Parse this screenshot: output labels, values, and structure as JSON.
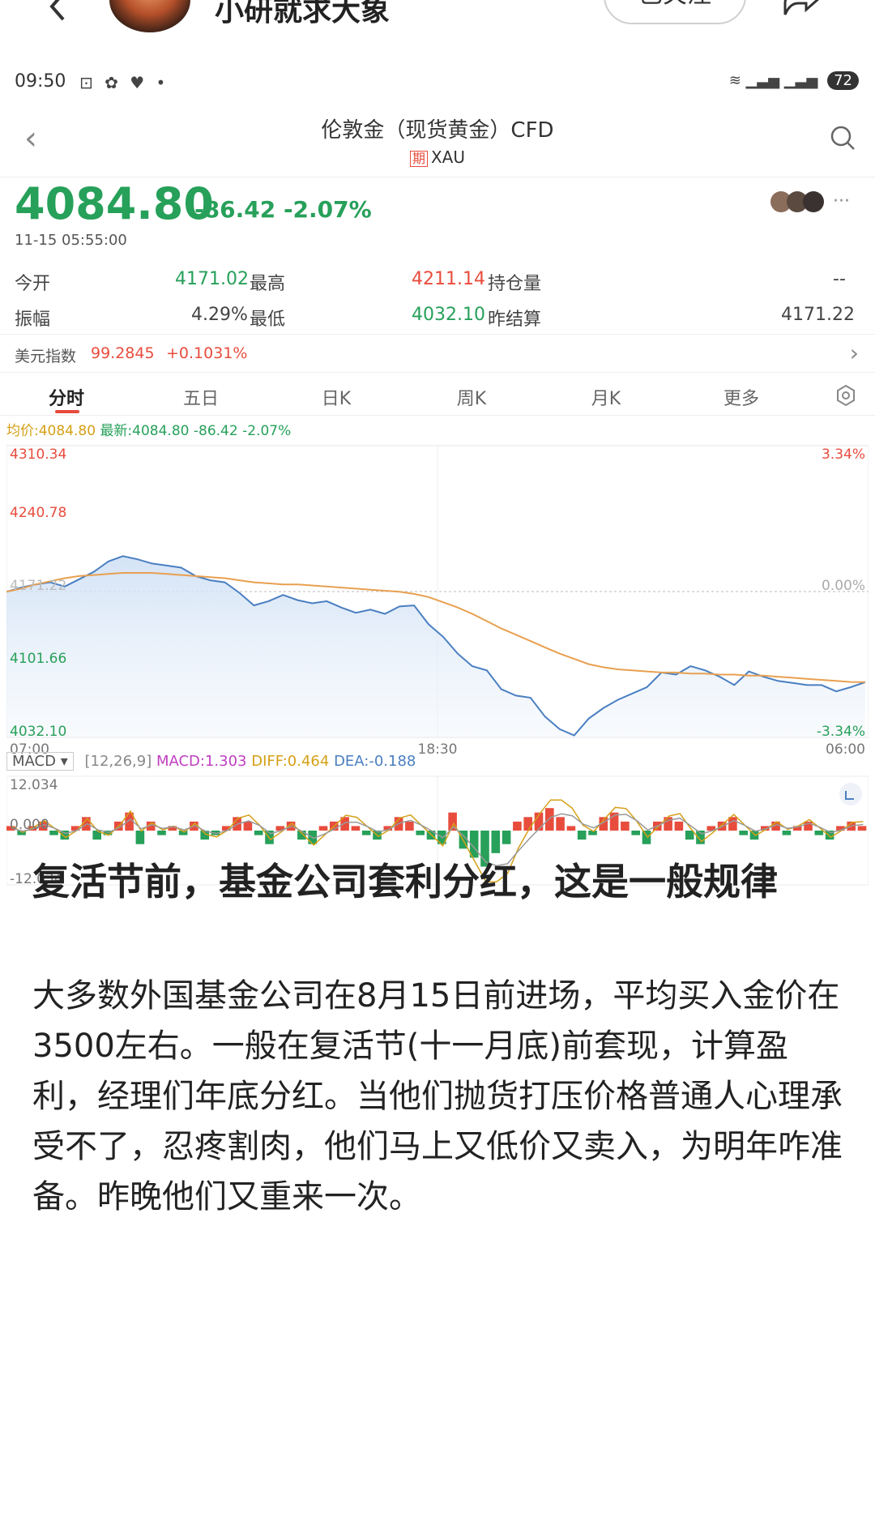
{
  "outer": {
    "author_name": "小研就求大象",
    "follow_label": "已关注"
  },
  "status_bar": {
    "time": "09:50",
    "battery": "72"
  },
  "header": {
    "title": "伦敦金（现货黄金）CFD",
    "badge": "期",
    "symbol": "XAU"
  },
  "quote": {
    "price": "4084.80",
    "change": "-86.42",
    "change_pct": "-2.07%",
    "timestamp": "11-15 05:55:00"
  },
  "stats": {
    "open_label": "今开",
    "open": "4171.02",
    "high_label": "最高",
    "high": "4211.14",
    "oi_label": "持仓量",
    "oi": "--",
    "amp_label": "振幅",
    "amp": "4.29%",
    "low_label": "最低",
    "low": "4032.10",
    "prev_label": "昨结算",
    "prev": "4171.22"
  },
  "dxy": {
    "label": "美元指数",
    "value": "99.2845",
    "change": "+0.1031%"
  },
  "tabs": [
    "分时",
    "五日",
    "日K",
    "周K",
    "月K",
    "更多"
  ],
  "legend": {
    "avg": "均价:4084.80",
    "latest": "最新:4084.80",
    "change": "-86.42",
    "pct": "-2.07%"
  },
  "chart_data": [
    {
      "type": "line",
      "y_ticks_left": [
        "4310.34",
        "4240.78",
        "4171.22",
        "4101.66",
        "4032.10"
      ],
      "y_ticks_right": [
        "3.34%",
        "0.00%",
        "-3.34%"
      ],
      "x_ticks": [
        "07:00",
        "18:30",
        "06:00"
      ],
      "ylim": [
        4032.1,
        4310.34
      ],
      "series": [
        {
          "values": [
            4171,
            4175,
            4178,
            4180,
            4176,
            4183,
            4190,
            4200,
            4205,
            4202,
            4198,
            4196,
            4194,
            4186,
            4182,
            4180,
            4170,
            4158,
            4162,
            4168,
            4163,
            4160,
            4162,
            4156,
            4151,
            4154,
            4150,
            4157,
            4158,
            4140,
            4128,
            4112,
            4100,
            4096,
            4078,
            4072,
            4070,
            4052,
            4040,
            4034,
            4050,
            4060,
            4068,
            4074,
            4080,
            4094,
            4092,
            4100,
            4096,
            4090,
            4082,
            4095,
            4090,
            4086,
            4084,
            4082,
            4082,
            4076,
            4080,
            4084.8
          ],
          "color": "#4a7fc1"
        },
        {
          "values": [
            4171,
            4174,
            4178,
            4181,
            4184,
            4186,
            4187,
            4188,
            4189,
            4189,
            4189,
            4188,
            4187,
            4186,
            4185,
            4184,
            4182,
            4180,
            4179,
            4178,
            4178,
            4177,
            4176,
            4175,
            4174,
            4173,
            4172,
            4171,
            4169,
            4166,
            4161,
            4156,
            4150,
            4143,
            4136,
            4130,
            4124,
            4118,
            4112,
            4107,
            4102,
            4099,
            4097,
            4096,
            4095,
            4094,
            4094,
            4093,
            4093,
            4092,
            4092,
            4091,
            4091,
            4090,
            4089,
            4088,
            4087,
            4086,
            4085,
            4084.8
          ],
          "color": "#e8a050"
        }
      ]
    },
    {
      "type": "bar",
      "title": "MACD",
      "params": "[12,26,9]",
      "macd": "MACD:1.303",
      "diff": "DIFF:0.464",
      "dea": "DEA:-0.188",
      "y_ticks": [
        "12.034",
        "0.000",
        "-12.034"
      ],
      "ylim": [
        -12.034,
        12.034
      ],
      "values": [
        1,
        -1,
        1,
        2,
        -1,
        -2,
        1,
        3,
        -2,
        -1,
        2,
        4,
        -3,
        2,
        -1,
        1,
        -1,
        2,
        -2,
        -1,
        1,
        3,
        2,
        -1,
        -3,
        1,
        2,
        -2,
        -3,
        1,
        2,
        3,
        1,
        -1,
        -2,
        1,
        3,
        2,
        -1,
        -2,
        -3,
        4,
        -4,
        -6,
        -8,
        -5,
        -3,
        2,
        3,
        4,
        5,
        3,
        1,
        -2,
        -1,
        3,
        4,
        2,
        -1,
        -3,
        2,
        3,
        2,
        -2,
        -3,
        1,
        2,
        3,
        -1,
        -2,
        1,
        2,
        -1,
        1,
        2,
        -1,
        -2,
        1,
        2,
        1
      ],
      "series": [
        {
          "name": "DIFF",
          "color": "#d4a017"
        },
        {
          "name": "DEA",
          "color": "#999999"
        }
      ]
    }
  ],
  "article": {
    "title": "复活节前，基金公司套利分红，这是一般规律",
    "body": "大多数外国基金公司在8月15日前进场，平均买入金价在3500左右。一般在复活节(十一月底)前套现，计算盈利，经理们年底分红。当他们抛货打压价格普通人心理承受不了，忍疼割肉，他们马上又低价又卖入，为明年咋准备。昨晚他们又重来一次。"
  }
}
